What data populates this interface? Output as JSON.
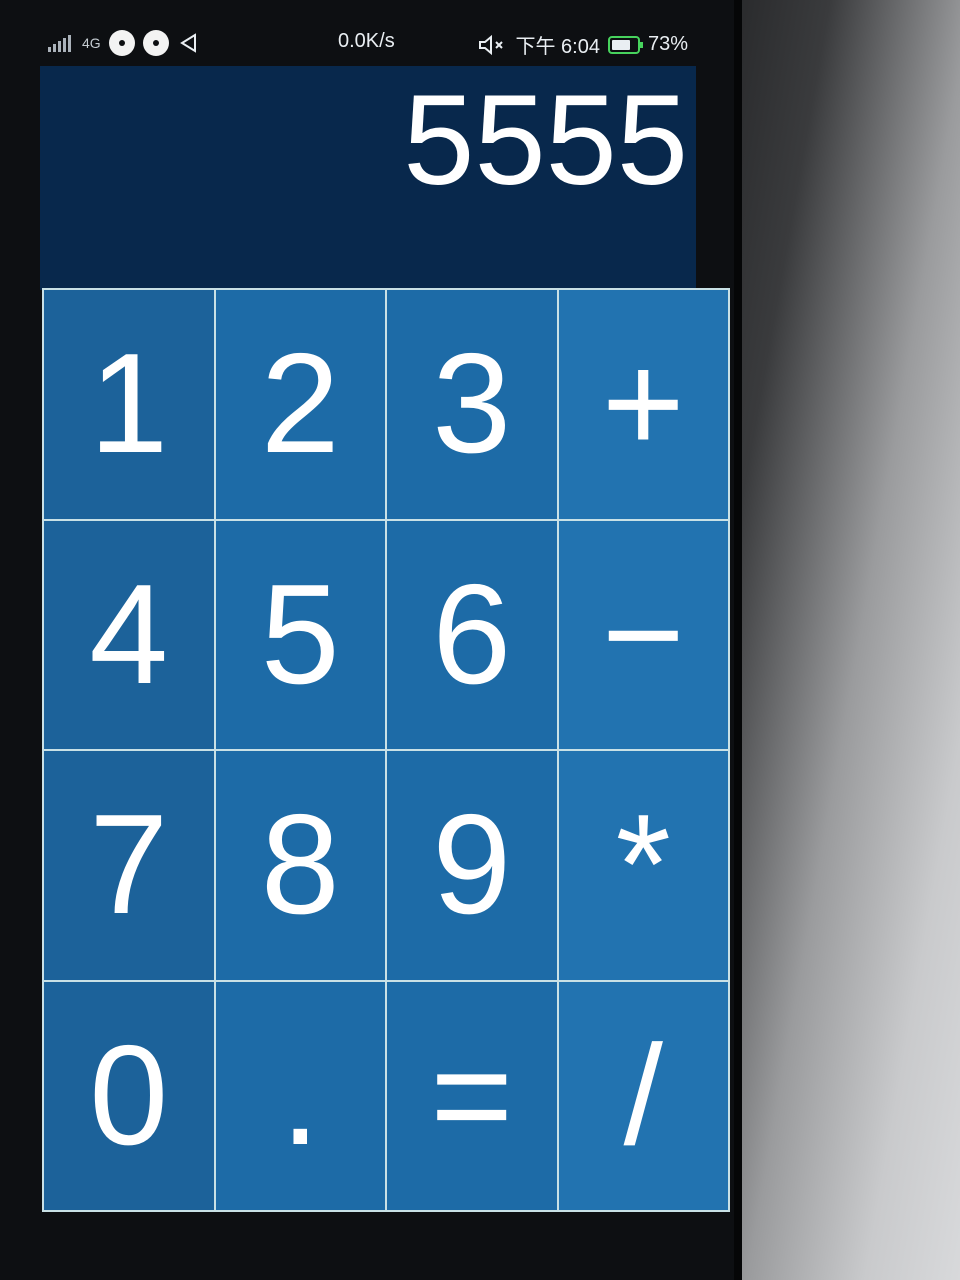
{
  "status_bar": {
    "network": "4G",
    "speed": "0.0K/s",
    "time": "下午 6:04",
    "battery": "73%"
  },
  "display": {
    "value": "5555"
  },
  "keypad": {
    "keys": [
      "1",
      "2",
      "3",
      "+",
      "4",
      "5",
      "6",
      "−",
      "7",
      "8",
      "9",
      "*",
      "0",
      ".",
      "=",
      "/"
    ]
  },
  "colors": {
    "display_bg": "#08284c",
    "key_bg": "#1d6ba7",
    "grid_line": "#c9e1e6",
    "battery": "#47d35d"
  }
}
